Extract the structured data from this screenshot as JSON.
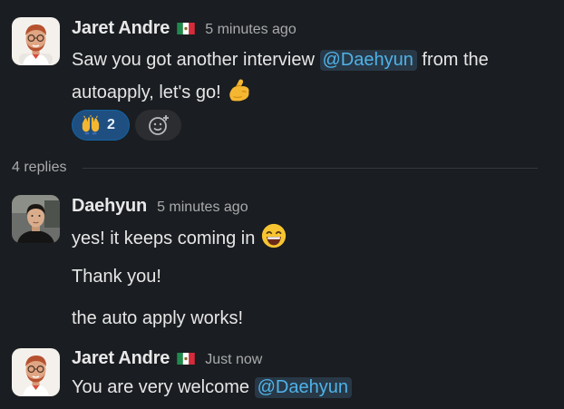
{
  "thread": {
    "parent": {
      "author": "Jaret Andre",
      "flag": "mexico-flag",
      "time": "5 minutes ago",
      "text_before": "Saw you got another interview ",
      "mention": "@Daehyun",
      "text_after": " from the",
      "line2": "autoapply, let's go! ",
      "emoji": "flexed-biceps",
      "reactions": [
        {
          "emoji": "raising-hands",
          "count": "2"
        }
      ],
      "add_reaction_icon": "add-reaction-icon"
    },
    "replies_label": "4 replies",
    "replies": [
      {
        "author": "Daehyun",
        "time": "5 minutes ago",
        "lines": [
          "yes! it keeps coming in ",
          "Thank you!",
          "the auto apply works!"
        ],
        "emoji": "grinning-smile"
      },
      {
        "author": "Jaret Andre",
        "flag": "mexico-flag",
        "time": "Just now",
        "text_before": "You are very welcome ",
        "mention": "@Daehyun"
      }
    ]
  },
  "colors": {
    "background": "#1a1d21",
    "mention_text": "#4fb3e8",
    "mention_bg": "#283847",
    "reaction_active_bg": "#1f4f80",
    "reaction_active_border": "#1264a3"
  }
}
